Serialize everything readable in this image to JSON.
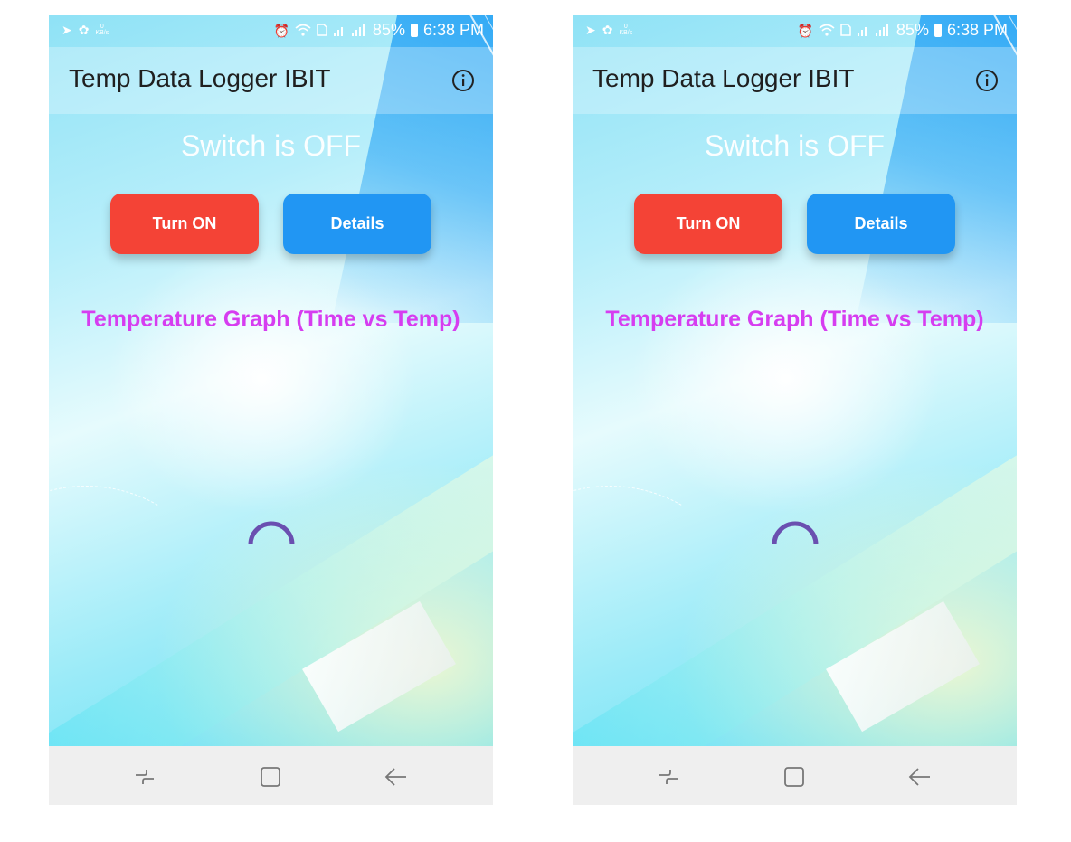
{
  "screens": [
    {
      "status": {
        "data_rate_value": "0",
        "data_rate_unit": "KB/s",
        "battery": "85%",
        "time": "6:38 PM"
      },
      "app_title": "Temp Data Logger IBIT",
      "switch_status": "Switch is OFF",
      "turn_on_label": "Turn ON",
      "details_label": "Details",
      "graph_title": "Temperature Graph (Time vs Temp)",
      "loading": true
    },
    {
      "status": {
        "data_rate_value": "0",
        "data_rate_unit": "KB/s",
        "battery": "85%",
        "time": "6:38 PM"
      },
      "app_title": "Temp Data Logger IBIT",
      "switch_status": "Switch is OFF",
      "turn_on_label": "Turn ON",
      "details_label": "Details",
      "graph_title": "Temperature Graph (Time vs Temp)",
      "loading": true
    }
  ],
  "icons": {
    "status_left": [
      "navigation-arrow-icon",
      "settings-gear-icon",
      "data-rate-icon"
    ],
    "status_right": [
      "alarm-clock-icon",
      "wifi-icon",
      "sim-card-icon",
      "signal-bars-icon",
      "battery-icon"
    ],
    "appbar": "info-icon",
    "navbar": [
      "recent-apps-icon",
      "home-icon",
      "back-icon"
    ]
  },
  "colors": {
    "turn_on_button": "#f44336",
    "details_button": "#2196f3",
    "graph_title": "#d63df0",
    "spinner": "#6a4fb0",
    "navbar": "#efefef"
  }
}
